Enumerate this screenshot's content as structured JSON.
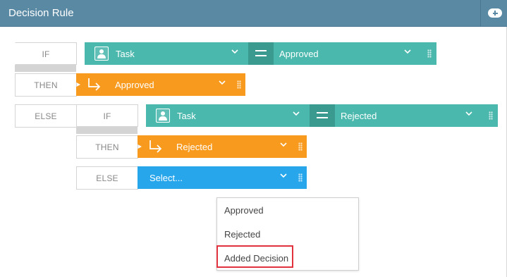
{
  "header": {
    "title": "Decision Rule",
    "add_icon": "add-pill-icon"
  },
  "rule": {
    "if_label": "IF",
    "then_label": "THEN",
    "else_label": "ELSE",
    "condition": {
      "left": "Task",
      "operator_icon": "equals-icon",
      "right": "Approved"
    },
    "then_value": "Approved",
    "nested": {
      "if_label": "IF",
      "then_label": "THEN",
      "else_label": "ELSE",
      "condition": {
        "left": "Task",
        "operator_icon": "equals-icon",
        "right": "Rejected"
      },
      "then_value": "Rejected",
      "else_select": {
        "placeholder": "Select..."
      }
    }
  },
  "dropdown": {
    "options": [
      "Approved",
      "Rejected",
      "Added Decision"
    ],
    "highlighted_option": "Added Decision"
  },
  "colors": {
    "teal": "#4ab8ad",
    "orange": "#f79a1e",
    "blue": "#27a6ec",
    "highlight": "#e0333d",
    "header": "#5a89a4"
  }
}
